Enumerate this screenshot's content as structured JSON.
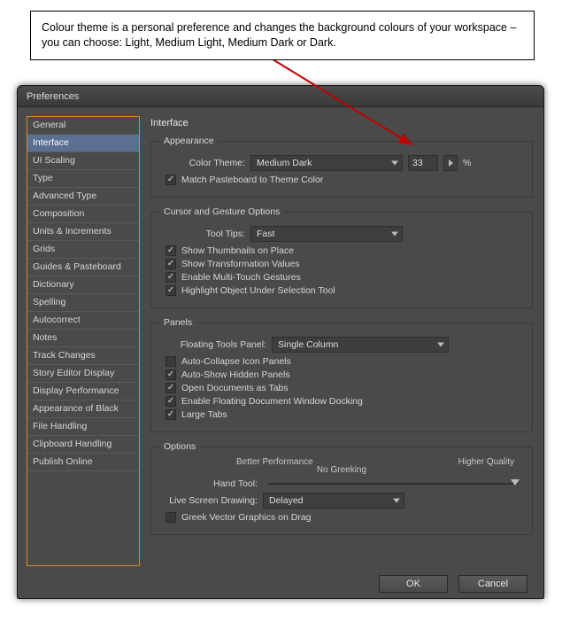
{
  "annotation": "Colour theme is a personal preference and changes the background colours of your workspace – you can choose: Light, Medium Light, Medium Dark or Dark.",
  "dialog": {
    "title": "Preferences"
  },
  "sidebar": {
    "items": [
      "General",
      "Interface",
      "UI Scaling",
      "Type",
      "Advanced Type",
      "Composition",
      "Units & Increments",
      "Grids",
      "Guides & Pasteboard",
      "Dictionary",
      "Spelling",
      "Autocorrect",
      "Notes",
      "Track Changes",
      "Story Editor Display",
      "Display Performance",
      "Appearance of Black",
      "File Handling",
      "Clipboard Handling",
      "Publish Online"
    ],
    "selected_index": 1
  },
  "main": {
    "title": "Interface",
    "appearance": {
      "legend": "Appearance",
      "color_theme_label": "Color Theme:",
      "color_theme_value": "Medium Dark",
      "value": "33",
      "percent": "%",
      "match_pasteboard": {
        "checked": true,
        "label": "Match Pasteboard to Theme Color"
      }
    },
    "cursor": {
      "legend": "Cursor and Gesture Options",
      "tooltips_label": "Tool Tips:",
      "tooltips_value": "Fast",
      "items": [
        {
          "checked": true,
          "label": "Show Thumbnails on Place"
        },
        {
          "checked": true,
          "label": "Show Transformation Values"
        },
        {
          "checked": true,
          "label": "Enable Multi-Touch Gestures"
        },
        {
          "checked": true,
          "label": "Highlight Object Under Selection Tool"
        }
      ]
    },
    "panels": {
      "legend": "Panels",
      "floating_label": "Floating Tools Panel:",
      "floating_value": "Single Column",
      "items": [
        {
          "checked": false,
          "label": "Auto-Collapse Icon Panels"
        },
        {
          "checked": true,
          "label": "Auto-Show Hidden Panels"
        },
        {
          "checked": true,
          "label": "Open Documents as Tabs"
        },
        {
          "checked": true,
          "label": "Enable Floating Document Window Docking"
        },
        {
          "checked": true,
          "label": "Large Tabs"
        }
      ]
    },
    "options": {
      "legend": "Options",
      "perf_left": "Better Performance",
      "perf_right": "Higher Quality",
      "no_greek": "No Greeking",
      "hand_tool": "Hand Tool:",
      "live_label": "Live Screen Drawing:",
      "live_value": "Delayed",
      "greek_vec": {
        "checked": false,
        "label": "Greek Vector Graphics on Drag"
      }
    }
  },
  "footer": {
    "ok": "OK",
    "cancel": "Cancel"
  }
}
